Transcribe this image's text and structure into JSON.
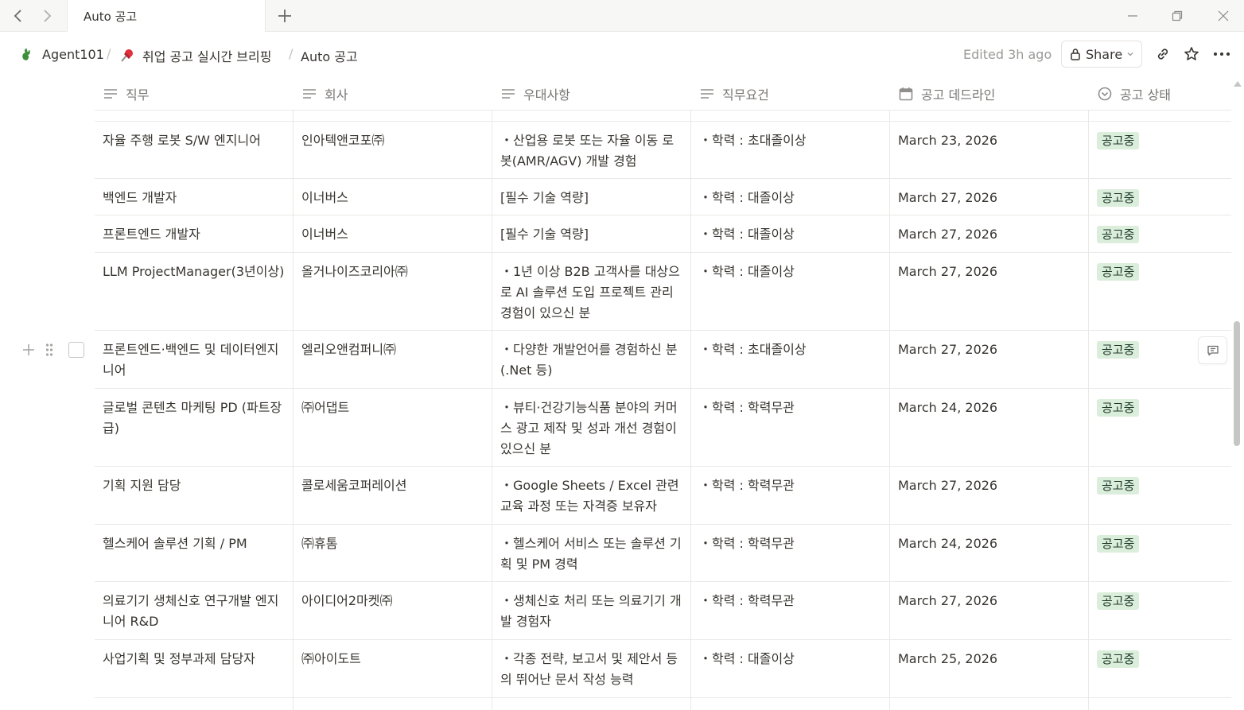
{
  "window": {
    "tab_title": "Auto 공고",
    "back_icon": "chevron-left-icon",
    "forward_icon": "chevron-right-icon",
    "new_tab_icon": "plus-icon"
  },
  "breadcrumb": [
    {
      "label": "Agent101",
      "icon": "dragon-icon"
    },
    {
      "label": "취업 공고 실시간 브리핑",
      "icon": "pushpin-icon"
    },
    {
      "label": "Auto 공고"
    }
  ],
  "breadcrumb_separator": "/",
  "topbar": {
    "edited": "Edited 3h ago",
    "share_label": "Share"
  },
  "table": {
    "columns": [
      {
        "label": "직무",
        "icon": "text-icon"
      },
      {
        "label": "회사",
        "icon": "text-icon"
      },
      {
        "label": "우대사항",
        "icon": "text-icon"
      },
      {
        "label": "직무요건",
        "icon": "text-icon"
      },
      {
        "label": "공고 데드라인",
        "icon": "calendar-icon"
      },
      {
        "label": "공고 상태",
        "icon": "status-icon"
      }
    ],
    "rows": [
      {
        "role": "자율 주행 로봇 S/W 엔지니어",
        "company": "인아텍앤코포㈜",
        "preferred": "・산업용 로봇 또는 자율 이동 로봇(AMR/AGV) 개발 경험",
        "requirement": "・학력 : 초대졸이상",
        "deadline": "March 23, 2026",
        "status": "공고중"
      },
      {
        "role": "백엔드 개발자",
        "company": "이너버스",
        "preferred": "[필수 기술 역량]",
        "requirement": "・학력 : 대졸이상",
        "deadline": "March 27, 2026",
        "status": "공고중"
      },
      {
        "role": "프론트엔드 개발자",
        "company": "이너버스",
        "preferred": "[필수 기술 역량]",
        "requirement": "・학력 : 대졸이상",
        "deadline": "March 27, 2026",
        "status": "공고중"
      },
      {
        "role": "LLM ProjectManager(3년이상)",
        "company": "올거나이즈코리아㈜",
        "preferred": "・1년 이상 B2B 고객사를 대상으로 AI 솔루션 도입 프로젝트 관리 경험이 있으신 분",
        "requirement": "・학력 : 대졸이상",
        "deadline": "March 27, 2026",
        "status": "공고중"
      },
      {
        "role": "프론트엔드·백엔드 및 데이터엔지니어",
        "company": "엘리오앤컴퍼니㈜",
        "preferred": "・다양한 개발언어를 경험하신 분(.Net 등)",
        "requirement": "・학력 : 초대졸이상",
        "deadline": "March 27, 2026",
        "status": "공고중"
      },
      {
        "role": "글로벌 콘텐츠 마케팅 PD (파트장급)",
        "company": "㈜어댑트",
        "preferred": "・뷰티·건강기능식품 분야의 커머스 광고 제작 및 성과 개선 경험이 있으신 분",
        "requirement": "・학력 : 학력무관",
        "deadline": "March 24, 2026",
        "status": "공고중"
      },
      {
        "role": "기획 지원 담당",
        "company": "콜로세움코퍼레이션",
        "preferred": "・Google Sheets / Excel 관련 교육 과정 또는 자격증 보유자",
        "requirement": "・학력 : 학력무관",
        "deadline": "March 27, 2026",
        "status": "공고중"
      },
      {
        "role": "헬스케어 솔루션 기획 / PM",
        "company": "㈜휴톰",
        "preferred": "・헬스케어 서비스 또는 솔루션 기획 및 PM 경력",
        "requirement": "・학력 : 학력무관",
        "deadline": "March 24, 2026",
        "status": "공고중"
      },
      {
        "role": "의료기기 생체신호 연구개발 엔지니어 R&D",
        "company": "아이디어2마켓㈜",
        "preferred": "・생체신호 처리 또는 의료기기 개발 경험자",
        "requirement": "・학력 : 학력무관",
        "deadline": "March 27, 2026",
        "status": "공고중"
      },
      {
        "role": "사업기획 및 정부과제 담당자",
        "company": "㈜아이도트",
        "preferred": "・각종 전략, 보고서 및 제안서 등의 뛰어난 문서 작성 능력",
        "requirement": "・학력 : 대졸이상",
        "deadline": "March 25, 2026",
        "status": "공고중"
      }
    ]
  },
  "colors": {
    "status_bg": "#dbeddb",
    "status_text": "#1c3829",
    "border": "#e9e9e7",
    "muted": "#787774"
  }
}
